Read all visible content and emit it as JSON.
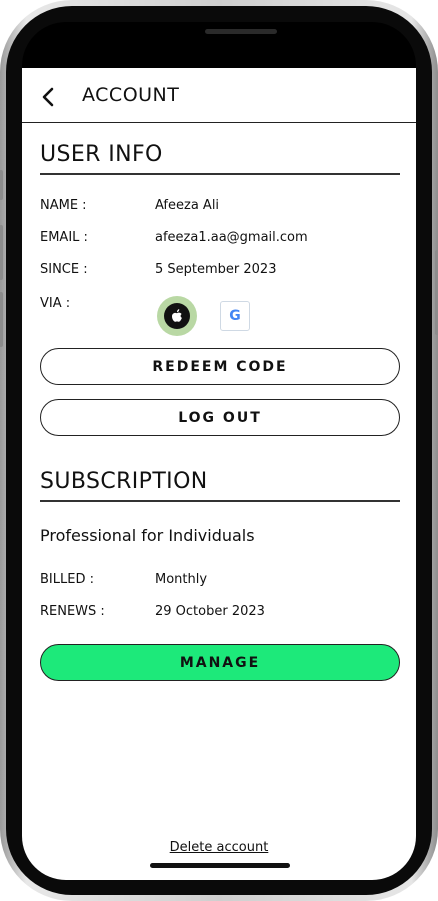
{
  "header": {
    "title": "ACCOUNT",
    "back_icon": "chevron-left-icon"
  },
  "user_info": {
    "title": "USER INFO",
    "name_label": "NAME :",
    "name_value": "Afeeza Ali",
    "email_label": "EMAIL :",
    "email_value": "afeeza1.aa@gmail.com",
    "since_label": "SINCE :",
    "since_value": "5 September 2023",
    "via_label": "VIA :",
    "via_providers": [
      "apple-icon",
      "google-icon"
    ],
    "apple_glyph": "",
    "google_glyph": "G"
  },
  "buttons": {
    "redeem": "REDEEM CODE",
    "logout": "LOG OUT",
    "manage": "MANAGE"
  },
  "subscription": {
    "title": "SUBSCRIPTION",
    "plan": "Professional for Individuals",
    "billed_label": "BILLED :",
    "billed_value": "Monthly",
    "renews_label": "RENEWS :",
    "renews_value": "29 October 2023"
  },
  "footer": {
    "delete_account": "Delete account"
  },
  "colors": {
    "manage_button": "#1de97a",
    "apple_ring": "#b9d8a4"
  }
}
